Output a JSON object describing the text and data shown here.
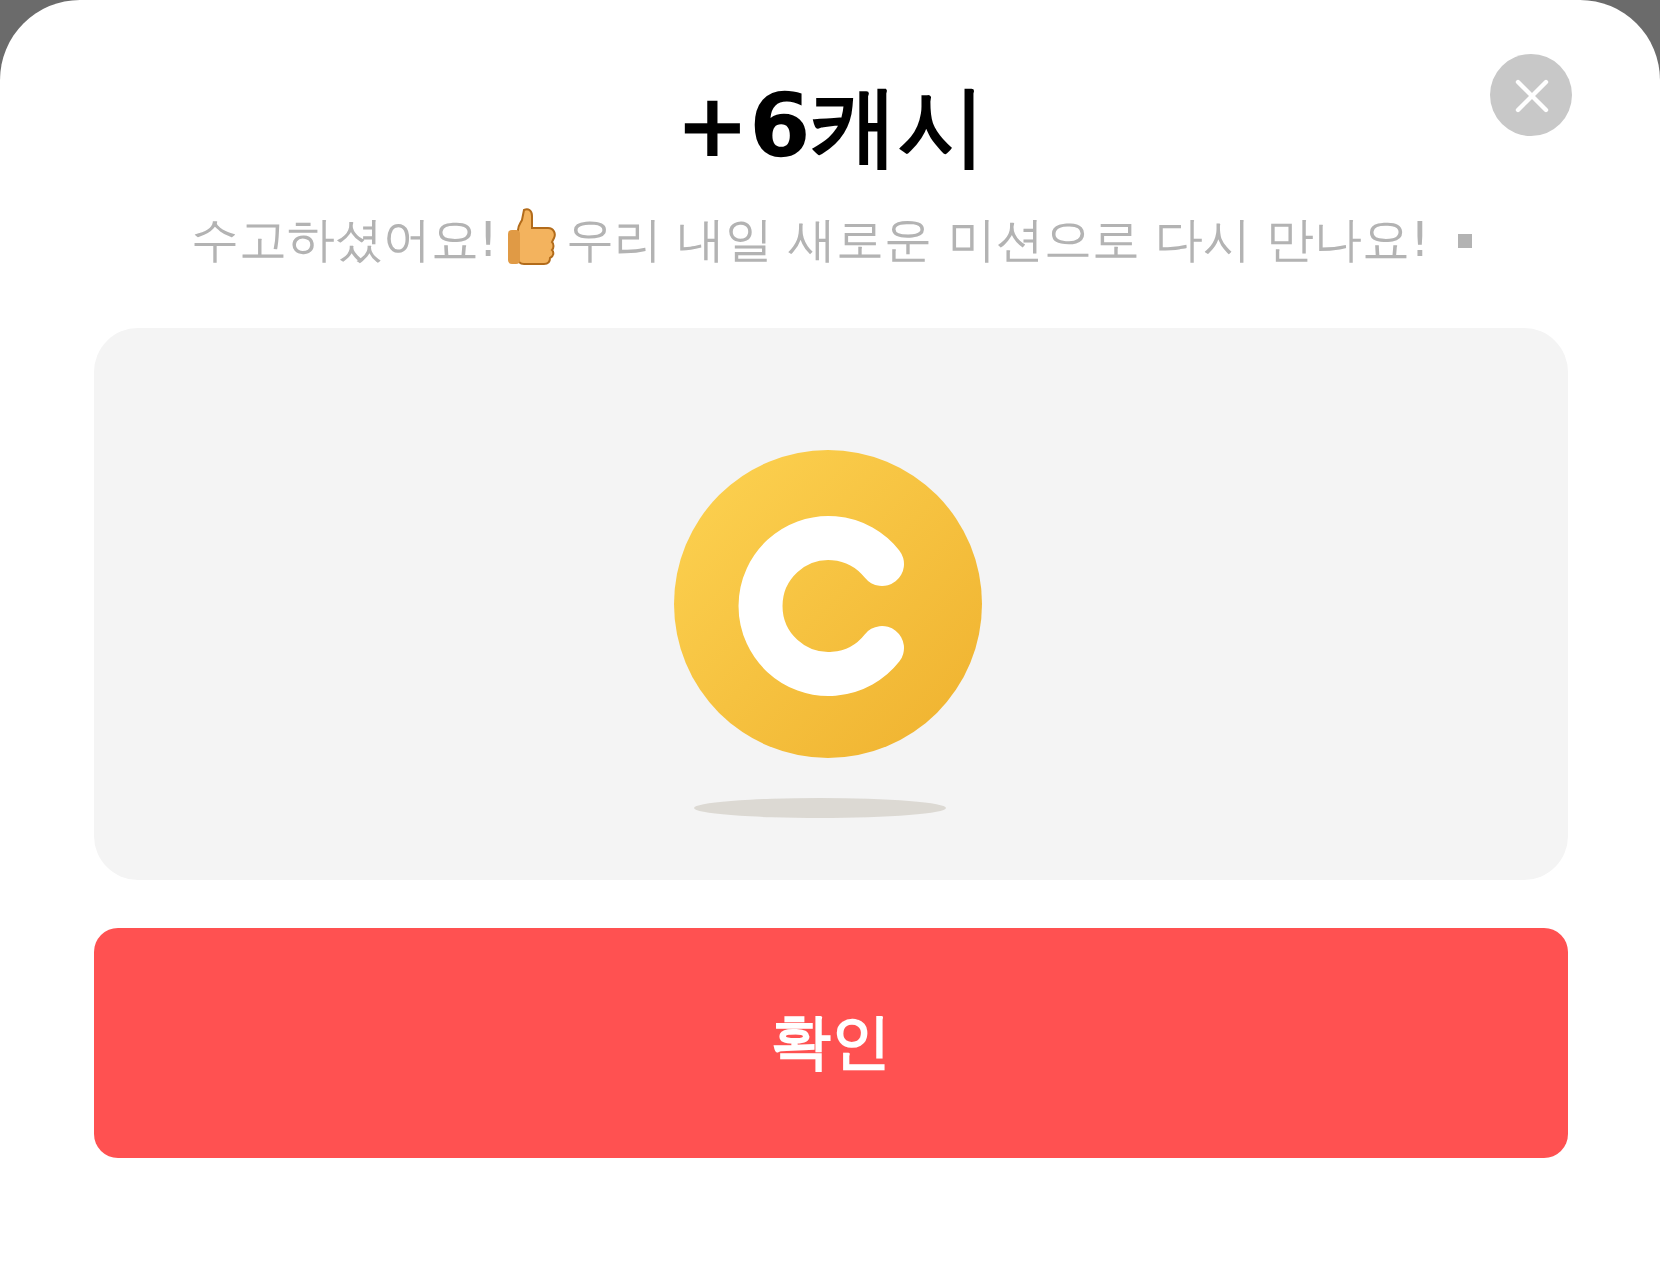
{
  "dialog": {
    "title": "+6캐시",
    "message_start": "수고하셨어요!",
    "message_end": "우리 내일 새로운 미션으로 다시 만나요!"
  },
  "buttons": [
    {
      "label": "확인"
    }
  ]
}
